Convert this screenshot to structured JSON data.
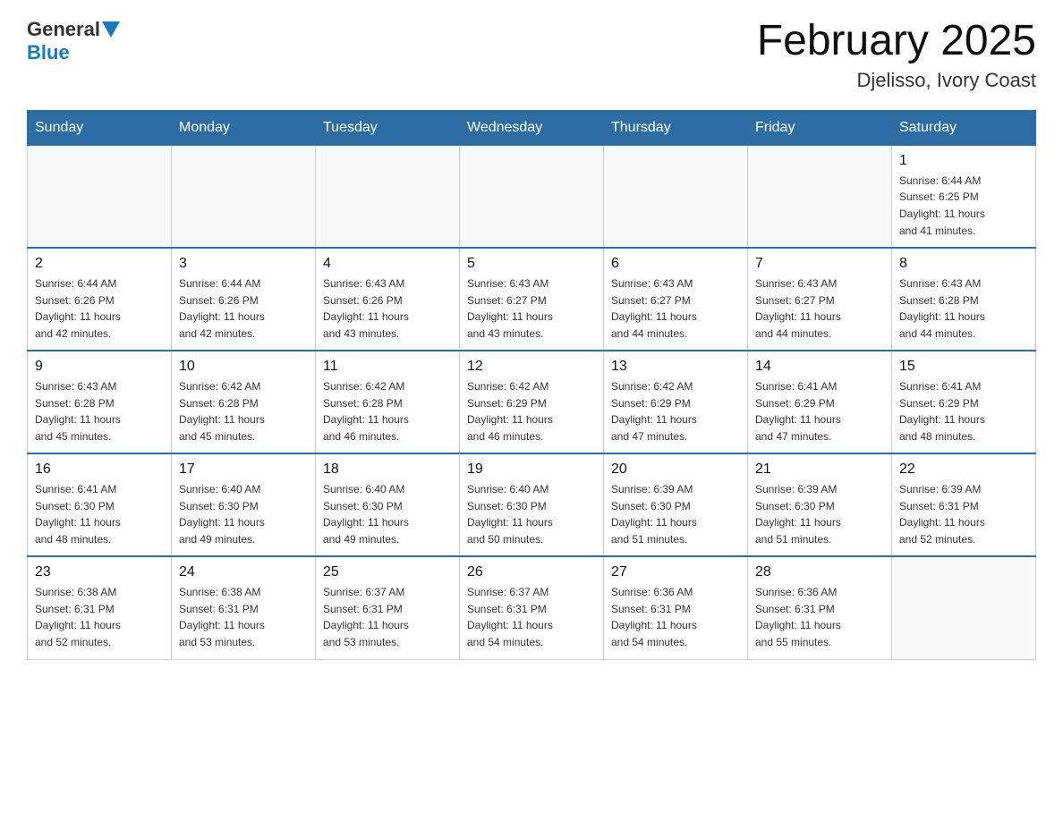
{
  "header": {
    "logo_general": "General",
    "logo_blue": "Blue",
    "month_title": "February 2025",
    "location": "Djelisso, Ivory Coast"
  },
  "weekdays": [
    "Sunday",
    "Monday",
    "Tuesday",
    "Wednesday",
    "Thursday",
    "Friday",
    "Saturday"
  ],
  "weeks": [
    [
      {
        "day": "",
        "info": ""
      },
      {
        "day": "",
        "info": ""
      },
      {
        "day": "",
        "info": ""
      },
      {
        "day": "",
        "info": ""
      },
      {
        "day": "",
        "info": ""
      },
      {
        "day": "",
        "info": ""
      },
      {
        "day": "1",
        "info": "Sunrise: 6:44 AM\nSunset: 6:25 PM\nDaylight: 11 hours\nand 41 minutes."
      }
    ],
    [
      {
        "day": "2",
        "info": "Sunrise: 6:44 AM\nSunset: 6:26 PM\nDaylight: 11 hours\nand 42 minutes."
      },
      {
        "day": "3",
        "info": "Sunrise: 6:44 AM\nSunset: 6:26 PM\nDaylight: 11 hours\nand 42 minutes."
      },
      {
        "day": "4",
        "info": "Sunrise: 6:43 AM\nSunset: 6:26 PM\nDaylight: 11 hours\nand 43 minutes."
      },
      {
        "day": "5",
        "info": "Sunrise: 6:43 AM\nSunset: 6:27 PM\nDaylight: 11 hours\nand 43 minutes."
      },
      {
        "day": "6",
        "info": "Sunrise: 6:43 AM\nSunset: 6:27 PM\nDaylight: 11 hours\nand 44 minutes."
      },
      {
        "day": "7",
        "info": "Sunrise: 6:43 AM\nSunset: 6:27 PM\nDaylight: 11 hours\nand 44 minutes."
      },
      {
        "day": "8",
        "info": "Sunrise: 6:43 AM\nSunset: 6:28 PM\nDaylight: 11 hours\nand 44 minutes."
      }
    ],
    [
      {
        "day": "9",
        "info": "Sunrise: 6:43 AM\nSunset: 6:28 PM\nDaylight: 11 hours\nand 45 minutes."
      },
      {
        "day": "10",
        "info": "Sunrise: 6:42 AM\nSunset: 6:28 PM\nDaylight: 11 hours\nand 45 minutes."
      },
      {
        "day": "11",
        "info": "Sunrise: 6:42 AM\nSunset: 6:28 PM\nDaylight: 11 hours\nand 46 minutes."
      },
      {
        "day": "12",
        "info": "Sunrise: 6:42 AM\nSunset: 6:29 PM\nDaylight: 11 hours\nand 46 minutes."
      },
      {
        "day": "13",
        "info": "Sunrise: 6:42 AM\nSunset: 6:29 PM\nDaylight: 11 hours\nand 47 minutes."
      },
      {
        "day": "14",
        "info": "Sunrise: 6:41 AM\nSunset: 6:29 PM\nDaylight: 11 hours\nand 47 minutes."
      },
      {
        "day": "15",
        "info": "Sunrise: 6:41 AM\nSunset: 6:29 PM\nDaylight: 11 hours\nand 48 minutes."
      }
    ],
    [
      {
        "day": "16",
        "info": "Sunrise: 6:41 AM\nSunset: 6:30 PM\nDaylight: 11 hours\nand 48 minutes."
      },
      {
        "day": "17",
        "info": "Sunrise: 6:40 AM\nSunset: 6:30 PM\nDaylight: 11 hours\nand 49 minutes."
      },
      {
        "day": "18",
        "info": "Sunrise: 6:40 AM\nSunset: 6:30 PM\nDaylight: 11 hours\nand 49 minutes."
      },
      {
        "day": "19",
        "info": "Sunrise: 6:40 AM\nSunset: 6:30 PM\nDaylight: 11 hours\nand 50 minutes."
      },
      {
        "day": "20",
        "info": "Sunrise: 6:39 AM\nSunset: 6:30 PM\nDaylight: 11 hours\nand 51 minutes."
      },
      {
        "day": "21",
        "info": "Sunrise: 6:39 AM\nSunset: 6:30 PM\nDaylight: 11 hours\nand 51 minutes."
      },
      {
        "day": "22",
        "info": "Sunrise: 6:39 AM\nSunset: 6:31 PM\nDaylight: 11 hours\nand 52 minutes."
      }
    ],
    [
      {
        "day": "23",
        "info": "Sunrise: 6:38 AM\nSunset: 6:31 PM\nDaylight: 11 hours\nand 52 minutes."
      },
      {
        "day": "24",
        "info": "Sunrise: 6:38 AM\nSunset: 6:31 PM\nDaylight: 11 hours\nand 53 minutes."
      },
      {
        "day": "25",
        "info": "Sunrise: 6:37 AM\nSunset: 6:31 PM\nDaylight: 11 hours\nand 53 minutes."
      },
      {
        "day": "26",
        "info": "Sunrise: 6:37 AM\nSunset: 6:31 PM\nDaylight: 11 hours\nand 54 minutes."
      },
      {
        "day": "27",
        "info": "Sunrise: 6:36 AM\nSunset: 6:31 PM\nDaylight: 11 hours\nand 54 minutes."
      },
      {
        "day": "28",
        "info": "Sunrise: 6:36 AM\nSunset: 6:31 PM\nDaylight: 11 hours\nand 55 minutes."
      },
      {
        "day": "",
        "info": ""
      }
    ]
  ]
}
